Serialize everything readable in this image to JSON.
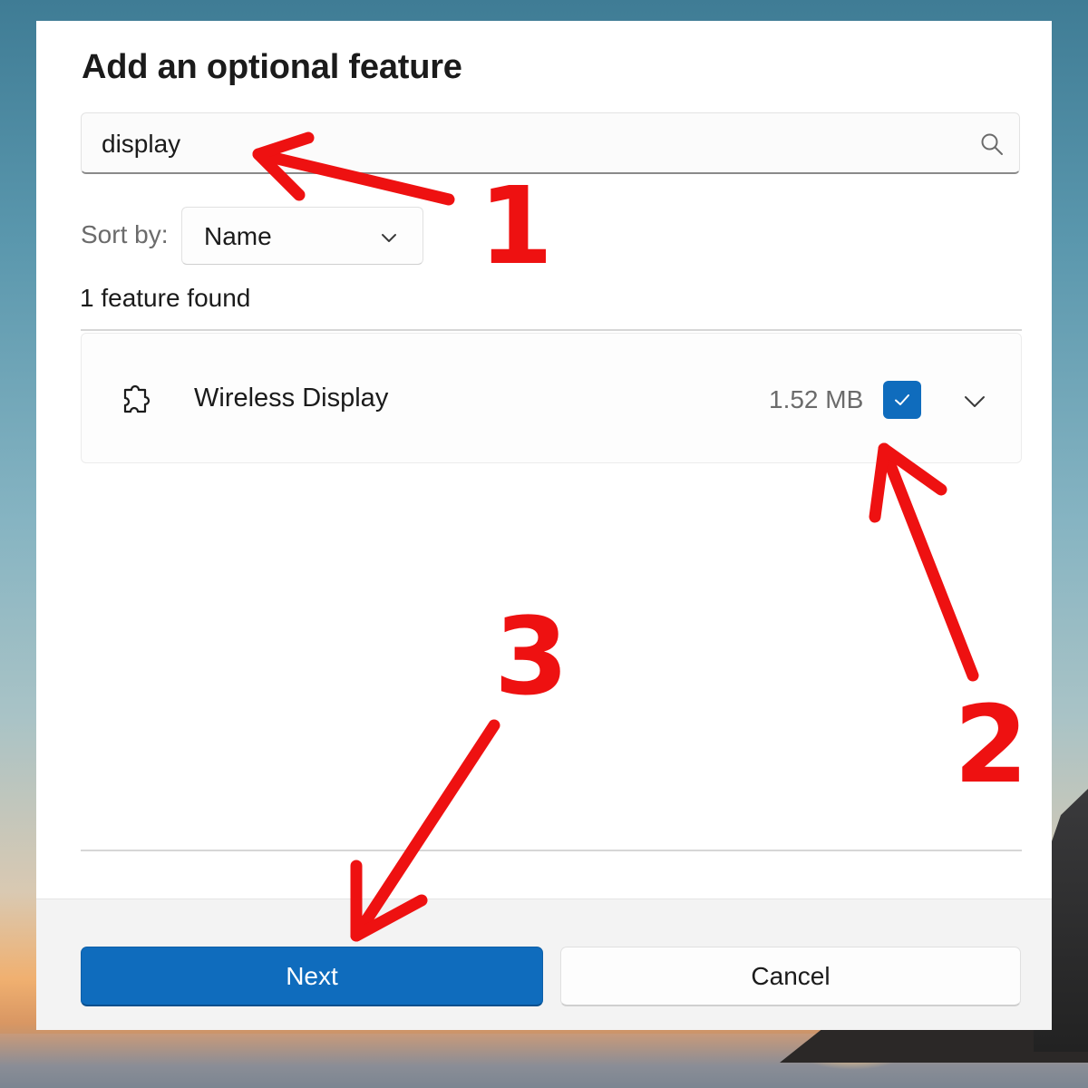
{
  "dialog": {
    "title": "Add an optional feature",
    "search": {
      "value": "display",
      "icon": "search-icon"
    },
    "sort": {
      "label": "Sort by:",
      "selected": "Name"
    },
    "results_count": "1 feature found",
    "features": [
      {
        "name": "Wireless Display",
        "size": "1.52 MB",
        "checked": true,
        "icon": "puzzle-icon"
      }
    ],
    "buttons": {
      "next_label": "Next",
      "cancel_label": "Cancel"
    },
    "colors": {
      "accent": "#0f6cbd",
      "annotation": "#ee1111"
    }
  },
  "annotations": {
    "step1": "1",
    "step2": "2",
    "step3": "3"
  }
}
